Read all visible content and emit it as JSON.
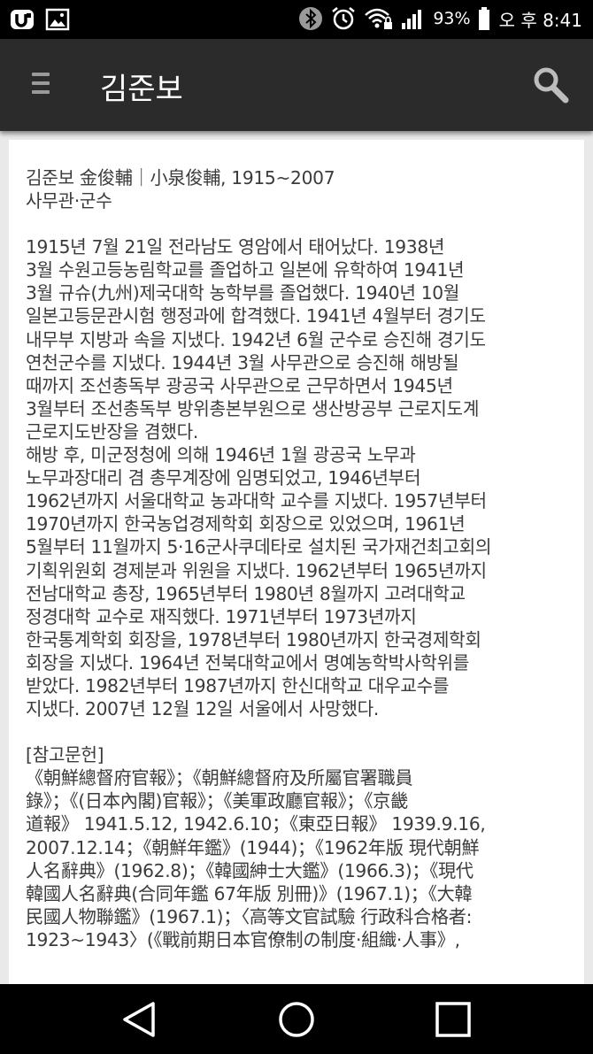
{
  "status_bar": {
    "icons": [
      "app-u-icon",
      "image-icon",
      "bluetooth-icon",
      "alarm-icon",
      "wifi-lock-icon",
      "signal-icon",
      "battery-icon"
    ],
    "battery": "93%",
    "time": "오 후  8:41"
  },
  "app_bar": {
    "title": "김준보",
    "icons": [
      "menu-icon",
      "search-icon"
    ]
  },
  "article": {
    "header_line1": "김준보 金俊輔｜小泉俊輔, 1915~2007",
    "header_line2": "사무관·군수",
    "para1": "1915년 7월 21일 전라남도 영암에서 태어났다. 1938년\n3월 수원고등농림학교를 졸업하고 일본에 유학하여 1941년\n3월 규슈(九州)제국대학 농학부를 졸업했다. 1940년 10월\n일본고등문관시험 행정과에 합격했다. 1941년 4월부터 경기도\n내무부 지방과 속을 지냈다. 1942년 6월 군수로 승진해 경기도\n연천군수를 지냈다. 1944년 3월 사무관으로 승진해 해방될\n때까지 조선총독부 광공국 사무관으로 근무하면서 1945년\n3월부터 조선총독부 방위총본부원으로 생산방공부 근로지도계\n근로지도반장을 겸했다.",
    "para2": "해방 후, 미군정청에 의해 1946년 1월 광공국 노무과\n노무과장대리 겸 총무계장에 임명되었고, 1946년부터\n1962년까지 서울대학교 농과대학 교수를 지냈다. 1957년부터\n1970년까지 한국농업경제학회 회장으로 있었으며, 1961년\n5월부터 11월까지 5·16군사쿠데타로 설치된 국가재건최고회의\n기획위원회 경제분과 위원을 지냈다. 1962년부터 1965년까지\n전남대학교 총장, 1965년부터 1980년 8월까지 고려대학교\n정경대학 교수로 재직했다. 1971년부터 1973년까지\n한국통계학회 회장을, 1978년부터 1980년까지 한국경제학회\n회장을 지냈다. 1964년 전북대학교에서 명예농학박사학위를\n받았다. 1982년부터 1987년까지 한신대학교 대우교수를\n지냈다. 2007년 12월 12일 서울에서 사망했다.",
    "refs_heading": "[참고문헌]",
    "refs": "《朝鮮總督府官報》；《朝鮮總督府及所屬官署職員\n錄》；《(日本內閣)官報》；《美軍政廳官報》；《京畿\n道報》 1941.5.12, 1942.6.10；《東亞日報》 1939.9.16,\n2007.12.14；《朝鮮年鑑》(1944)；《1962年版 現代朝鮮\n人名辭典》(1962.8)；《韓國紳士大鑑》(1966.3)；《現代\n韓國人名辭典(合同年鑑 67年版 別冊)》(1967.1)；《大韓\n民國人物聯鑑》(1967.1)；〈高等文官試驗 行政科合格者:\n1923~1943〉(《戰前期日本官僚制の制度·組織·人事》,"
  },
  "nav_bar": {
    "icons": [
      "back-icon",
      "home-icon",
      "recents-icon"
    ]
  }
}
